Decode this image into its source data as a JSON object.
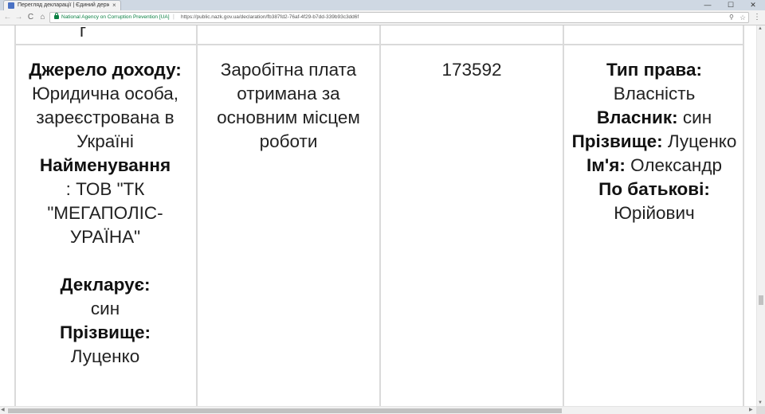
{
  "browser": {
    "tab_title": "Перегляд декларації | Єдиний державний реєстр",
    "tab_close": "×",
    "win_min": "—",
    "win_max": "☐",
    "win_close": "✕",
    "nav": {
      "back": "←",
      "forward": "→",
      "reload": "C",
      "home": "⌂",
      "zoom": "⚲",
      "star": "☆",
      "menu": "⋮"
    },
    "site_name": "National Agency on Corruption Prevention [UA]",
    "url_separator": "|",
    "url": "https://public.nazk.gov.ua/declaration/fb387fd2-76af-4f29-b7dd-339b93c3dd6f",
    "accent_secure": "#0b8043"
  },
  "page": {
    "top_row_stub": "г",
    "row": {
      "col1": {
        "source_label": "Джерело доходу:",
        "source_value_l1": "Юридична особа,",
        "source_value_l2": "зареєстрована в Україні",
        "name_label": "Найменування",
        "name_value": ": ТОВ \"ТК \"МЕГАПОЛІС-УРАЇНА\"",
        "declares_label": "Декларує:",
        "declares_value": "син",
        "surname_label": "Прізвище:",
        "surname_value": "Луценко"
      },
      "col2": {
        "income_type": "Заробітна плата отримана за основним місцем роботи"
      },
      "col3": {
        "amount": "173592"
      },
      "col4": {
        "right_type_label": "Тип права:",
        "right_type_value": "Власність",
        "owner_label": "Власник:",
        "owner_value": "син",
        "surname_label": "Прізвище:",
        "surname_value": "Луценко",
        "firstname_label": "Ім'я:",
        "firstname_value": "Олександр",
        "patronymic_label": "По батькові:",
        "patronymic_value": "Юрійович"
      }
    }
  },
  "scrollbars": {
    "up": "▲",
    "down": "▼",
    "left": "◀",
    "right": "▶"
  }
}
